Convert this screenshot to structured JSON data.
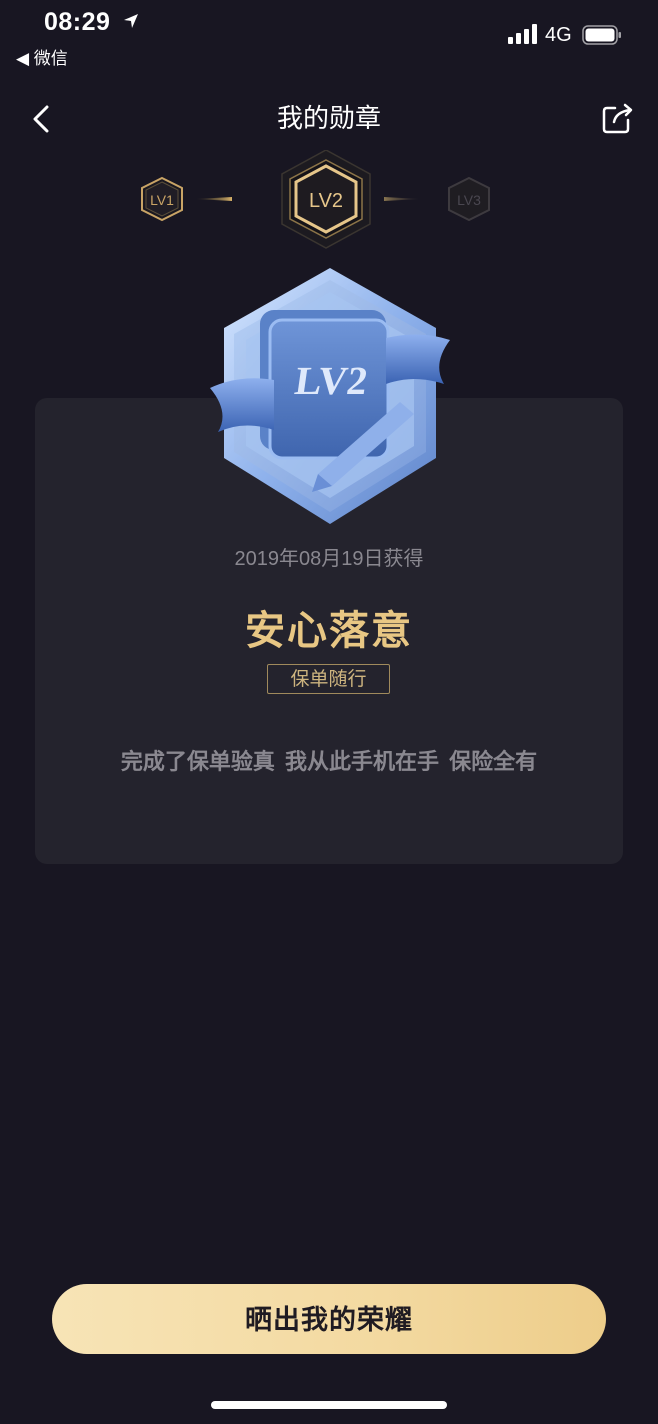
{
  "status": {
    "time": "08:29",
    "back_app": "◀ 微信",
    "network": "4G"
  },
  "nav": {
    "title": "我的勋章"
  },
  "levels": [
    {
      "label": "LV1",
      "state": "achieved"
    },
    {
      "label": "LV2",
      "state": "current"
    },
    {
      "label": "LV3",
      "state": "locked"
    }
  ],
  "medal": {
    "label": "LV2"
  },
  "card": {
    "earned_date": "2019年08月19日获得",
    "badge_name": "安心落意",
    "tag": "保单随行",
    "description": "完成了保单验真 我从此手机在手 保险全有"
  },
  "share_button": {
    "label": "晒出我的荣耀"
  },
  "colors": {
    "background": "#181622",
    "card": "#24232d",
    "gold": "#e8c784",
    "button_gradient_start": "#f7e4b6",
    "button_gradient_end": "#edcd8a"
  }
}
